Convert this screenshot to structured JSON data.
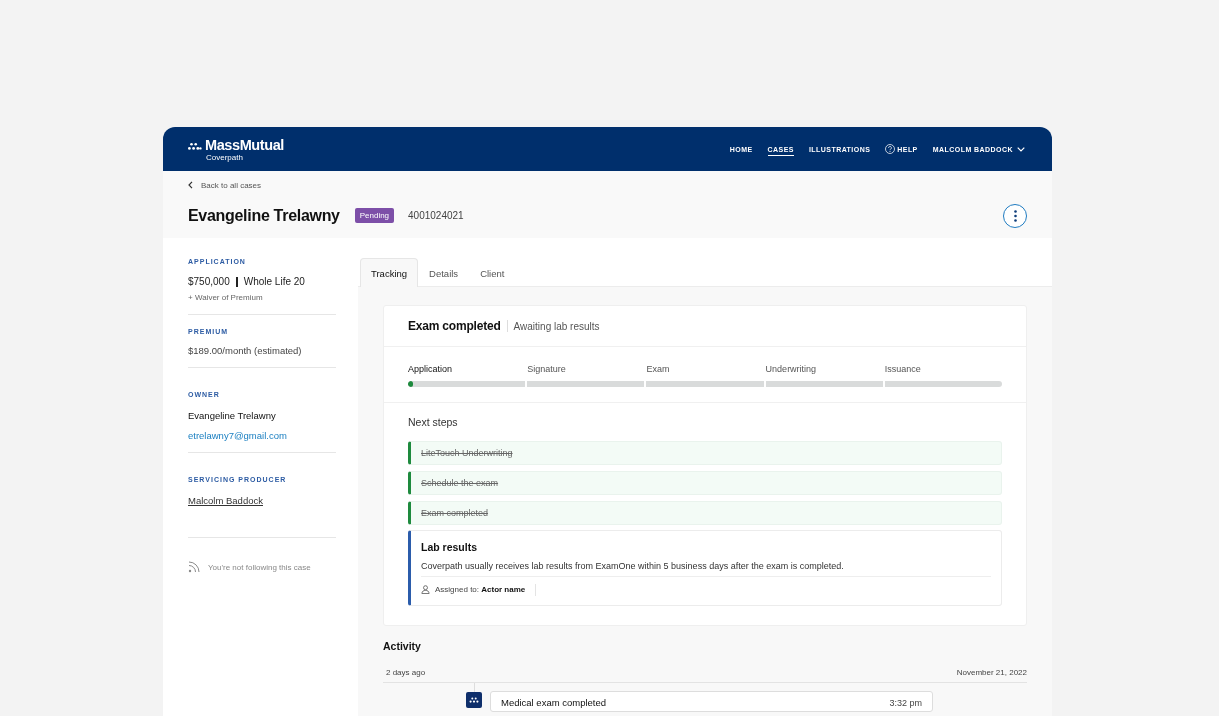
{
  "nav": {
    "brand": {
      "name": "MassMutual",
      "product": "Coverpath"
    },
    "links": [
      {
        "label": "HOME",
        "selected": false,
        "kind": "text"
      },
      {
        "label": "CASES",
        "selected": true,
        "kind": "text"
      },
      {
        "label": "ILLUSTRATIONS",
        "selected": false,
        "kind": "text"
      },
      {
        "label": "HELP",
        "selected": false,
        "kind": "help"
      }
    ],
    "user_menu": {
      "label": "MALCOLM BADDOCK"
    }
  },
  "case_header": {
    "back_link": "Back to all cases",
    "name": "Evangeline Trelawny",
    "status": "Pending",
    "case_number": "4001024021"
  },
  "sidebar": {
    "application": {
      "heading": "APPLICATION",
      "amount": "$750,000",
      "plan": "Whole Life 20",
      "rider": "+ Waiver of Premium"
    },
    "premium": {
      "heading": "PREMIUM",
      "value": "$189.00/month (estimated)"
    },
    "owner": {
      "heading": "OWNER",
      "name": "Evangeline Trelawny",
      "email": "etrelawny7@gmail.com"
    },
    "servicing_producer": {
      "heading": "SERVICING PRODUCER",
      "name": "Malcolm Baddock"
    },
    "follow": {
      "label": "You're not following this case"
    }
  },
  "tabs": [
    {
      "label": "Tracking",
      "selected": true
    },
    {
      "label": "Details",
      "selected": false
    },
    {
      "label": "Client",
      "selected": false
    }
  ],
  "tracking": {
    "status": "Exam completed",
    "substatus": "Awaiting lab results",
    "stages": [
      {
        "label": "Application",
        "current": true,
        "level": 0.04
      },
      {
        "label": "Signature",
        "current": false
      },
      {
        "label": "Exam",
        "current": false
      },
      {
        "label": "Underwriting",
        "current": false
      },
      {
        "label": "Issuance",
        "current": false
      }
    ],
    "next_steps": {
      "heading": "Next steps",
      "items": [
        {
          "kind": "done",
          "label": "LiteTouch Underwriting"
        },
        {
          "kind": "done",
          "label": "Schedule the exam"
        },
        {
          "kind": "done",
          "label": "Exam completed"
        },
        {
          "kind": "task",
          "title": "Lab results",
          "description": "Coverpath usually receives lab results from ExamOne within 5 business days after the exam is completed.",
          "assignment": "Assigned to: **Actor name**"
        }
      ]
    }
  },
  "activity": {
    "heading": "Activity",
    "groups": [
      {
        "relative": "2 days ago",
        "date": "November 21, 2022",
        "events": [
          {
            "title": "Medical exam completed",
            "time": "3:32 pm"
          }
        ]
      }
    ]
  }
}
